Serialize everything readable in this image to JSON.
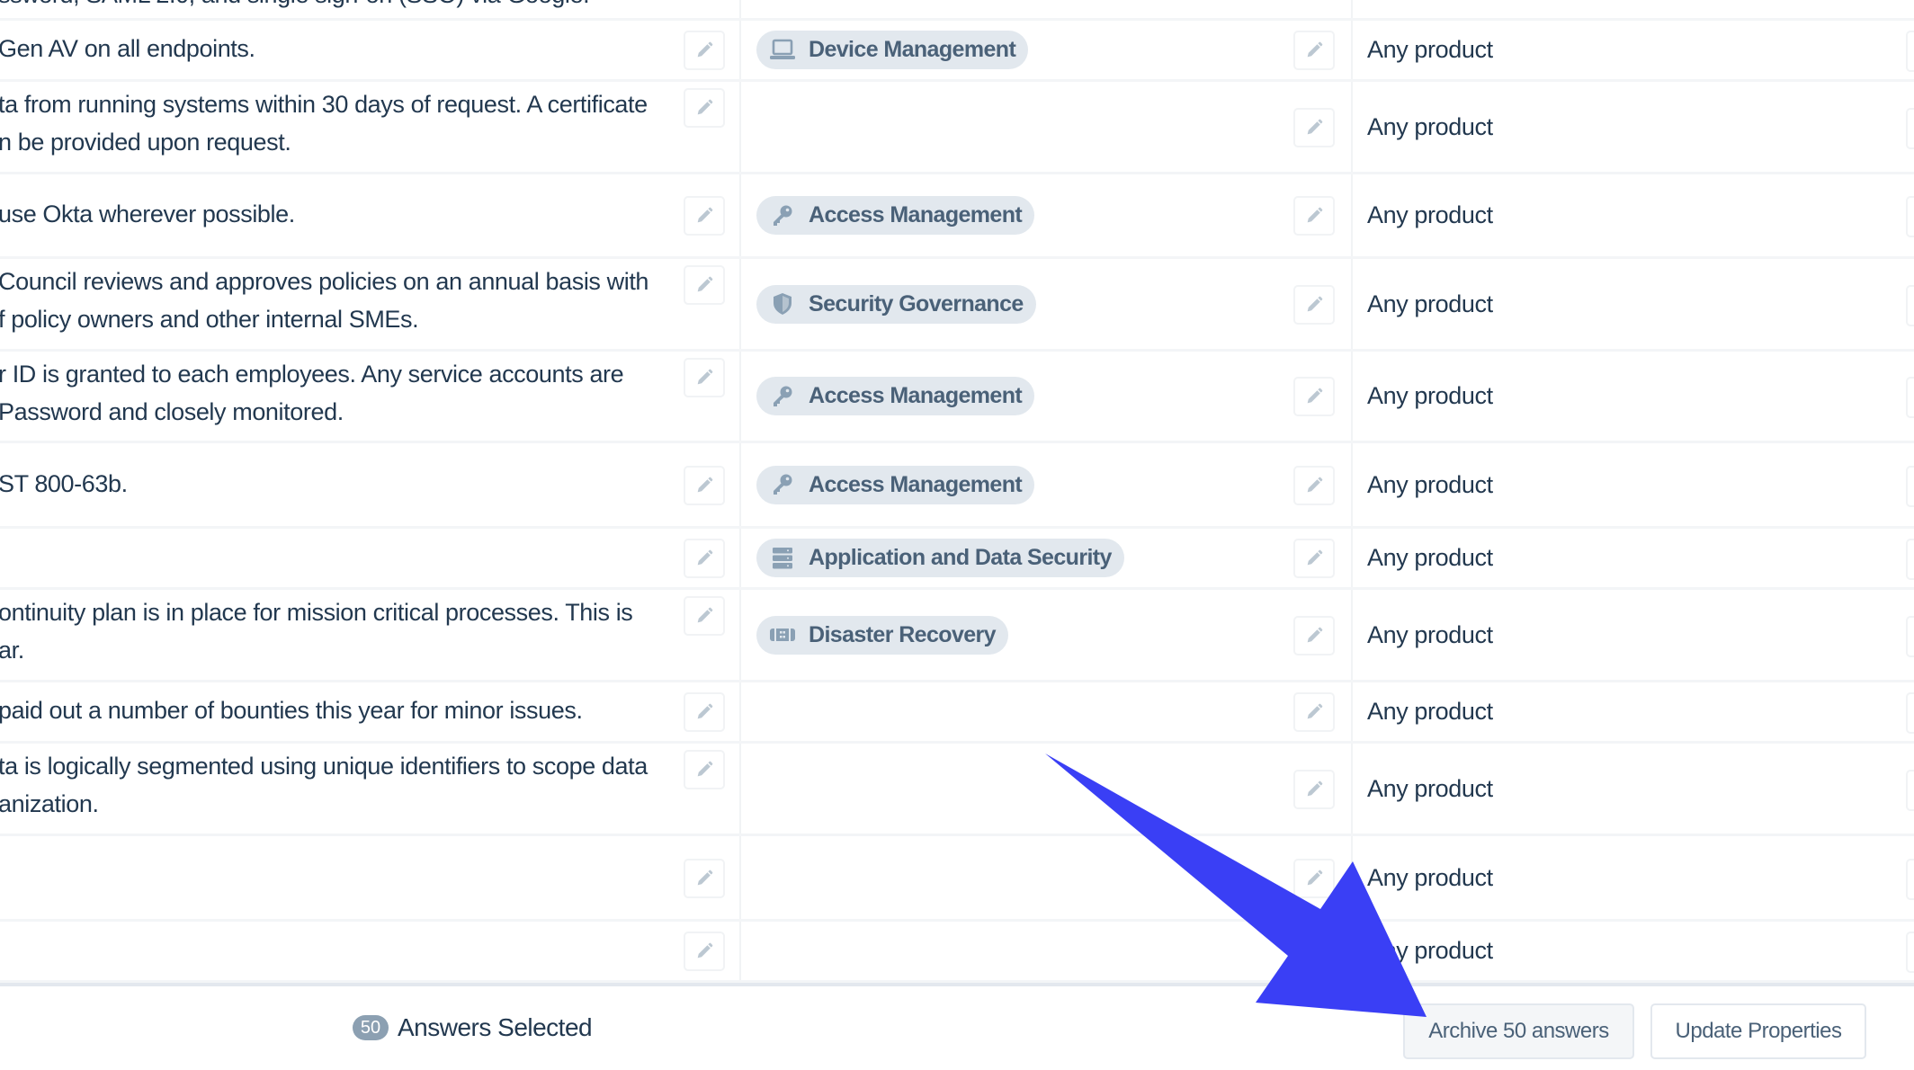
{
  "table": {
    "rows": [
      {
        "answer": "ssword, SAML 2.0, and single sign-on (SSO) via Google.",
        "tag": null,
        "product": null,
        "partial": true
      },
      {
        "answer": "Gen AV on all endpoints.",
        "tag": {
          "label": "Device Management",
          "icon": "laptop-icon"
        },
        "product": "Any product"
      },
      {
        "answer": "ta from running systems within 30 days of request. A certificate\nn be provided upon request.",
        "tag": null,
        "product": "Any product"
      },
      {
        "answer": "use Okta wherever possible.",
        "tag": {
          "label": "Access Management",
          "icon": "key-icon"
        },
        "product": "Any product"
      },
      {
        "answer": "Council reviews and approves policies on an annual basis with\nf policy owners and other internal SMEs.",
        "tag": {
          "label": "Security Governance",
          "icon": "shield-icon"
        },
        "product": "Any product"
      },
      {
        "answer": "r ID is granted to each employees. Any service accounts are\nPassword and closely monitored.",
        "tag": {
          "label": "Access Management",
          "icon": "key-icon"
        },
        "product": "Any product"
      },
      {
        "answer": "ST 800-63b.",
        "tag": {
          "label": "Access Management",
          "icon": "key-icon"
        },
        "product": "Any product"
      },
      {
        "answer": "",
        "tag": {
          "label": "Application and Data Security",
          "icon": "server-icon"
        },
        "product": "Any product"
      },
      {
        "answer": "ontinuity plan is in place for mission critical processes. This is\nar.",
        "tag": {
          "label": "Disaster Recovery",
          "icon": "battery-icon"
        },
        "product": "Any product"
      },
      {
        "answer": "paid out a number of bounties this year for minor issues.",
        "tag": null,
        "product": "Any product"
      },
      {
        "answer": "ta is logically segmented using unique identifiers to scope data\nanization.",
        "tag": null,
        "product": "Any product"
      },
      {
        "answer": "",
        "tag": null,
        "product": "Any product"
      },
      {
        "answer": "",
        "tag": null,
        "product": "Any product"
      }
    ]
  },
  "footer": {
    "selected_count": "50",
    "selected_label": "Answers Selected",
    "archive_label": "Archive 50 answers",
    "update_label": "Update Properties"
  },
  "annotation": {
    "type": "arrow",
    "color": "#3a3ff5",
    "points_to": "archive-button"
  },
  "colors": {
    "text": "#22384f",
    "tag_bg": "#e2e8ee",
    "tag_text": "#4a6178",
    "tag_icon": "#8aa0b4",
    "pencil_icon": "#bcc8d2",
    "badge_bg": "#8ca0b2"
  }
}
